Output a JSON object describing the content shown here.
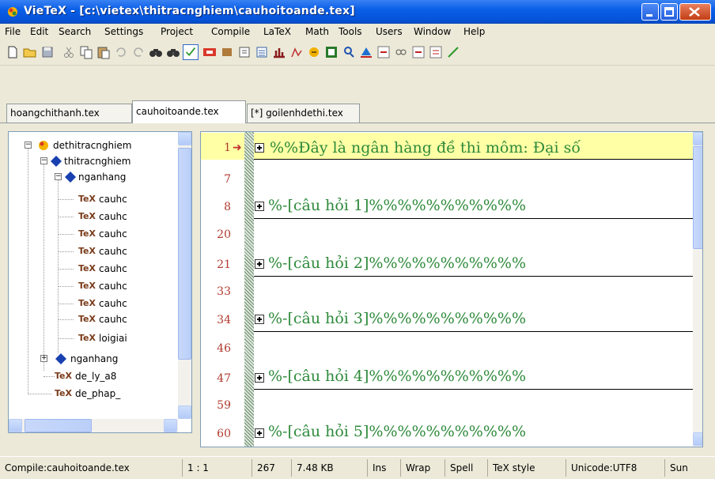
{
  "window": {
    "title": "VieTeX - [c:\\vietex\\thitracnghiem\\cauhoitoande.tex]"
  },
  "menu": [
    "File",
    "Edit",
    "Search",
    "Settings",
    "Project",
    "Compile",
    "LaTeX",
    "Math",
    "Tools",
    "Users",
    "Window",
    "Help"
  ],
  "toolbar_icons": [
    "new-file-icon",
    "open-folder-icon",
    "save-icon",
    "cut-icon",
    "copy-icon",
    "paste-icon",
    "undo-icon",
    "redo-icon",
    "find-icon",
    "find-next-icon",
    "spellcheck-icon",
    "highlight-icon",
    "book-icon",
    "settings-icon",
    "list-icon",
    "structure-icon",
    "chart-icon",
    "puzzle-icon",
    "matrix-icon",
    "search-person-icon",
    "triangle-icon",
    "dvi-ps-icon",
    "view-icon",
    "ps-pdf-icon",
    "pdf-icon",
    "draw-icon"
  ],
  "tabs": [
    {
      "label": "hoangchithanh.tex",
      "active": false
    },
    {
      "label": "cauhoitoande.tex",
      "active": true
    },
    {
      "label": "[*] goilenhdethi.tex",
      "active": false
    }
  ],
  "tree": {
    "root": "dethitracnghiem",
    "level1": "thitracnghiem",
    "group1": "nganhang",
    "files": [
      "cauhc",
      "cauhc",
      "cauhc",
      "cauhc",
      "cauhc",
      "cauhc",
      "cauhc",
      "cauhc",
      "loigiai"
    ],
    "group2": "nganhang",
    "extra_files": [
      "de_ly_a8",
      "de_phap_"
    ]
  },
  "editor": {
    "lines": [
      {
        "num": "1",
        "text": "%%Đây là ngân hàng đề thi môm: Đại số",
        "current": true
      },
      {
        "num": "7",
        "text": ""
      },
      {
        "num": "8",
        "text": "%-[câu hỏi 1]%%%%%%%%%%%"
      },
      {
        "num": "20",
        "text": ""
      },
      {
        "num": "21",
        "text": "%-[câu hỏi 2]%%%%%%%%%%%"
      },
      {
        "num": "33",
        "text": ""
      },
      {
        "num": "34",
        "text": "%-[câu hỏi 3]%%%%%%%%%%%"
      },
      {
        "num": "46",
        "text": ""
      },
      {
        "num": "47",
        "text": "%-[câu hỏi 4]%%%%%%%%%%%"
      },
      {
        "num": "59",
        "text": ""
      },
      {
        "num": "60",
        "text": "%-[câu hỏi 5]%%%%%%%%%%%"
      }
    ]
  },
  "status": {
    "compile": "Compile:cauhoitoande.tex",
    "position": "1 : 1",
    "lines": "267",
    "size": "7.48 KB",
    "mode": "Ins",
    "wrap": "Wrap",
    "spell": "Spell",
    "style": "TeX style",
    "encoding": "Unicode:UTF8",
    "day": "Sun"
  }
}
